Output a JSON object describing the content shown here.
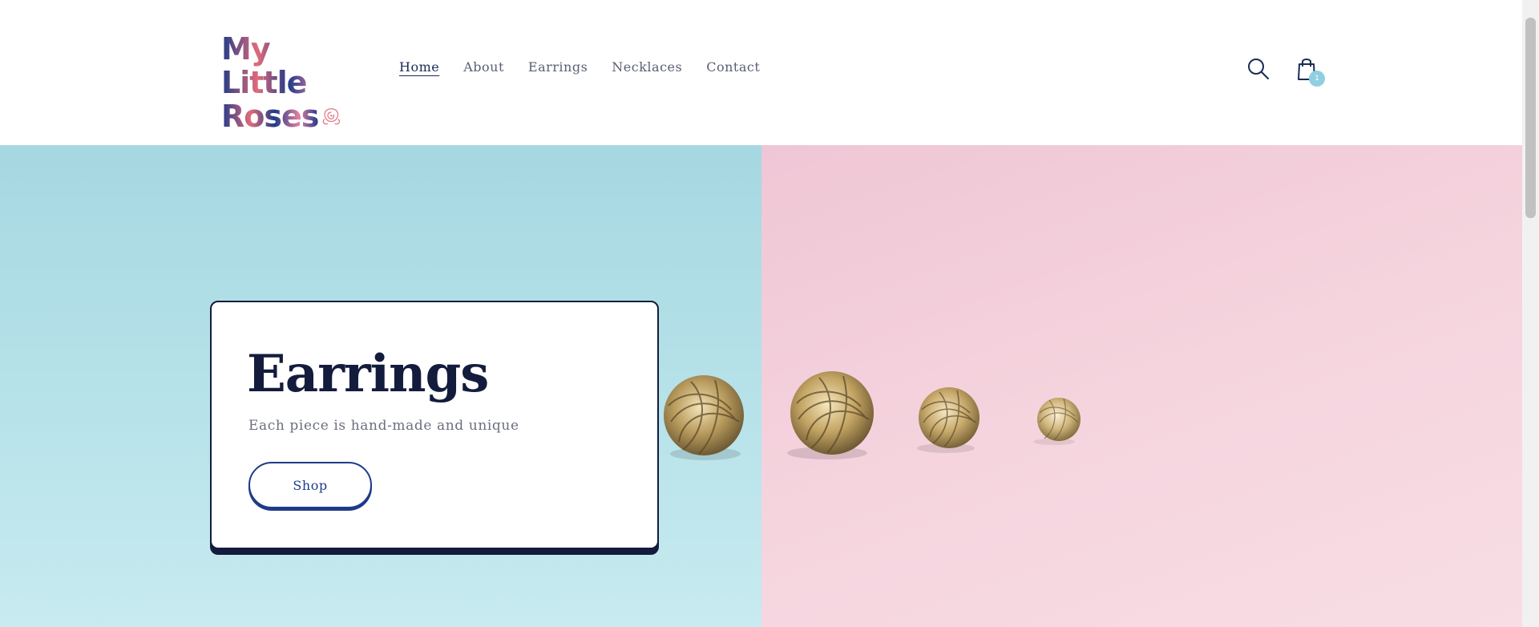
{
  "header": {
    "logo": {
      "line1": "My Little",
      "line2": "Roses",
      "icon": "rose-icon"
    },
    "nav": [
      {
        "label": "Home",
        "active": true
      },
      {
        "label": "About",
        "active": false
      },
      {
        "label": "Earrings",
        "active": false
      },
      {
        "label": "Necklaces",
        "active": false
      },
      {
        "label": "Contact",
        "active": false
      }
    ],
    "icons": {
      "search": "search-icon",
      "cart": "shopping-bag-icon",
      "cart_count": "1"
    }
  },
  "hero": {
    "title": "Earrings",
    "subtitle": "Each piece is hand-made and unique",
    "button_label": "Shop",
    "colors": {
      "left_background": "#b9e3ea",
      "right_background": "#f5d4de",
      "accent": "#141c3d",
      "button": "#1f3a8a",
      "badge": "#8ecfe0"
    }
  }
}
